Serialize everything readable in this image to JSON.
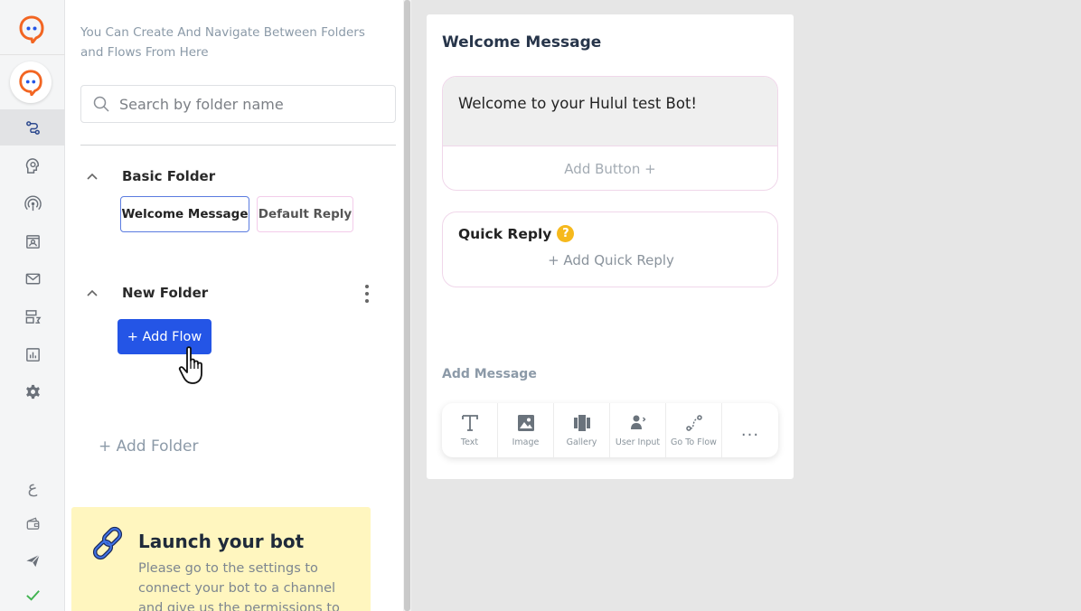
{
  "sidebar": {
    "brand_color": "#f26522",
    "items": [
      {
        "icon": "flows-icon",
        "active": true
      },
      {
        "icon": "bot-brain-icon"
      },
      {
        "icon": "broadcast-icon"
      },
      {
        "icon": "contacts-icon"
      },
      {
        "icon": "mail-icon"
      },
      {
        "icon": "templates-icon"
      },
      {
        "icon": "analytics-icon"
      },
      {
        "icon": "settings-gear-icon"
      }
    ],
    "language_glyph": "ع"
  },
  "folders": {
    "hint": "You Can Create And Navigate Between Folders and Flows From Here",
    "search_placeholder": "Search by folder name",
    "list": [
      {
        "name": "Basic Folder",
        "flows": [
          "Welcome Message",
          "Default Reply"
        ]
      },
      {
        "name": "New Folder",
        "flows": []
      }
    ],
    "add_flow_label": "+ Add Flow",
    "add_folder_label": "+ Add Folder"
  },
  "launch": {
    "title": "Launch your bot",
    "text": "Please go to the settings to connect your bot to a channel and give us the permissions to"
  },
  "editor": {
    "title": "Welcome Message",
    "message_text": "Welcome to your Hulul test Bot!",
    "add_button_label": "Add Button +",
    "quick_reply_title": "Quick Reply",
    "quick_reply_help": "?",
    "add_quick_reply_label": "+ Add Quick Reply",
    "add_message_label": "Add Message",
    "tools": [
      {
        "label": "Text",
        "icon": "text-icon"
      },
      {
        "label": "Image",
        "icon": "image-icon"
      },
      {
        "label": "Gallery",
        "icon": "gallery-icon"
      },
      {
        "label": "User Input",
        "icon": "user-input-icon"
      },
      {
        "label": "Go To Flow",
        "icon": "go-to-flow-icon"
      }
    ],
    "more_label": "..."
  }
}
